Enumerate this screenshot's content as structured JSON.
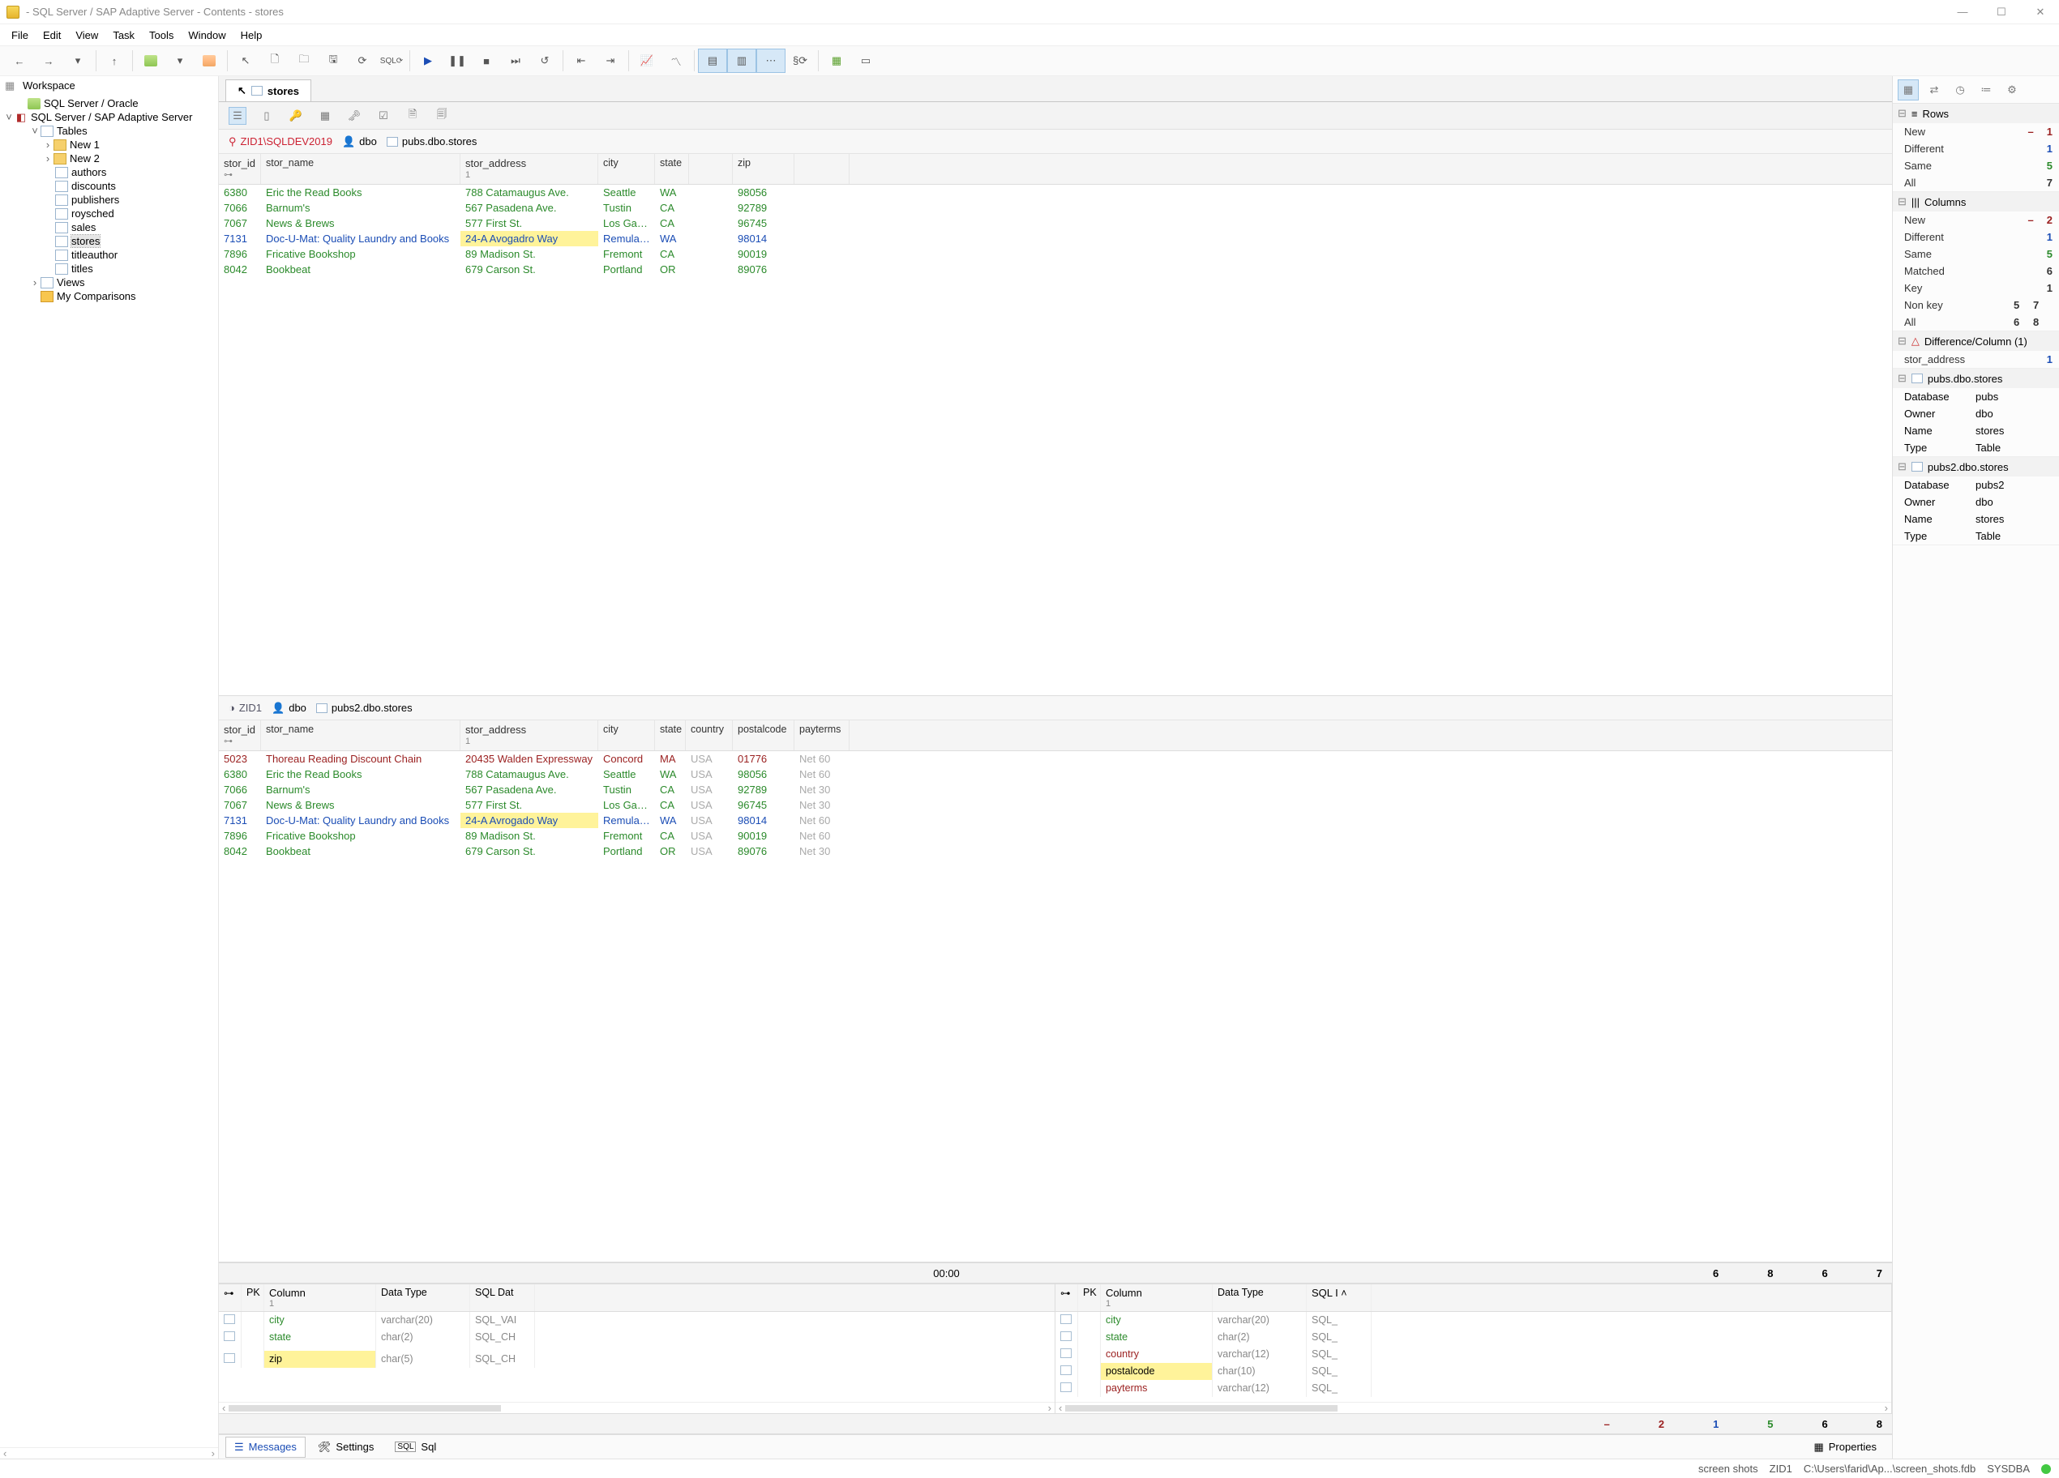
{
  "window": {
    "title": "- SQL Server / SAP Adaptive Server - Contents - stores"
  },
  "menu": [
    "File",
    "Edit",
    "View",
    "Task",
    "Tools",
    "Window",
    "Help"
  ],
  "workspace": {
    "label": "Workspace",
    "nodes": {
      "oracle": "SQL Server / Oracle",
      "sap": "SQL Server / SAP Adaptive Server",
      "tables": "Tables",
      "new1": "New 1",
      "new2": "New 2",
      "authors": "authors",
      "discounts": "discounts",
      "publishers": "publishers",
      "roysched": "roysched",
      "sales": "sales",
      "stores": "stores",
      "titleauthor": "titleauthor",
      "titles": "titles",
      "views": "Views",
      "mycomp": "My Comparisons"
    }
  },
  "tab": {
    "title": "stores"
  },
  "ctx_top": {
    "server": "ZID1\\SQLDEV2019",
    "user": "dbo",
    "path": "pubs.dbo.stores"
  },
  "ctx_bot": {
    "server": "ZID1",
    "user": "dbo",
    "path": "pubs2.dbo.stores"
  },
  "cols_top": [
    "stor_id",
    "stor_name",
    "stor_address",
    "city",
    "state",
    "",
    "zip"
  ],
  "cols_bot": [
    "stor_id",
    "stor_name",
    "stor_address",
    "city",
    "state",
    "country",
    "postalcode",
    "payterms"
  ],
  "subhead": "1",
  "rows_top": [
    {
      "cls": "match",
      "c": [
        "6380",
        "Eric the Read Books",
        "788 Catamaugus Ave.",
        "Seattle",
        "WA",
        "",
        "98056"
      ]
    },
    {
      "cls": "match",
      "c": [
        "7066",
        "Barnum's",
        "567 Pasadena Ave.",
        "Tustin",
        "CA",
        "",
        "92789"
      ]
    },
    {
      "cls": "match",
      "c": [
        "7067",
        "News & Brews",
        "577 First St.",
        "Los Gatos",
        "CA",
        "",
        "96745"
      ]
    },
    {
      "cls": "diff",
      "c": [
        "7131",
        "Doc-U-Mat: Quality Laundry and Books",
        "24-A Avogadro Way",
        "Remulade",
        "WA",
        "",
        "98014"
      ],
      "hl": 2
    },
    {
      "cls": "match",
      "c": [
        "7896",
        "Fricative Bookshop",
        "89 Madison St.",
        "Fremont",
        "CA",
        "",
        "90019"
      ]
    },
    {
      "cls": "match",
      "c": [
        "8042",
        "Bookbeat",
        "679 Carson St.",
        "Portland",
        "OR",
        "",
        "89076"
      ]
    }
  ],
  "rows_bot": [
    {
      "cls": "newrow",
      "c": [
        "5023",
        "Thoreau Reading Discount Chain",
        "20435 Walden Expressway",
        "Concord",
        "MA",
        "USA",
        "01776",
        "Net 60"
      ]
    },
    {
      "cls": "match",
      "c": [
        "6380",
        "Eric the Read Books",
        "788 Catamaugus Ave.",
        "Seattle",
        "WA",
        "USA",
        "98056",
        "Net 60"
      ]
    },
    {
      "cls": "match",
      "c": [
        "7066",
        "Barnum's",
        "567 Pasadena Ave.",
        "Tustin",
        "CA",
        "USA",
        "92789",
        "Net 30"
      ]
    },
    {
      "cls": "match",
      "c": [
        "7067",
        "News & Brews",
        "577 First St.",
        "Los Gatos",
        "CA",
        "USA",
        "96745",
        "Net 30"
      ]
    },
    {
      "cls": "diff",
      "c": [
        "7131",
        "Doc-U-Mat: Quality Laundry and Books",
        "24-A Avrogado Way",
        "Remulade",
        "WA",
        "USA",
        "98014",
        "Net 60"
      ],
      "hl": 2
    },
    {
      "cls": "match",
      "c": [
        "7896",
        "Fricative Bookshop",
        "89 Madison St.",
        "Fremont",
        "CA",
        "USA",
        "90019",
        "Net 60"
      ]
    },
    {
      "cls": "match",
      "c": [
        "8042",
        "Bookbeat",
        "679 Carson St.",
        "Portland",
        "OR",
        "USA",
        "89076",
        "Net 30"
      ]
    }
  ],
  "divbar": {
    "time": "00:00",
    "n1": "6",
    "n2": "8",
    "n3": "6",
    "n4": "7"
  },
  "schema_left": {
    "cols": [
      "",
      "PK",
      "Column",
      "Data Type",
      "SQL Dat"
    ],
    "rows": [
      {
        "name": "city",
        "type": "varchar(20)",
        "sql": "SQL_VAI",
        "cls": "green"
      },
      {
        "name": "state",
        "type": "char(2)",
        "sql": "SQL_CH",
        "cls": "green"
      },
      {
        "name": "",
        "type": "",
        "sql": "",
        "cls": ""
      },
      {
        "name": "zip",
        "type": "char(5)",
        "sql": "SQL_CH",
        "cls": "hl"
      }
    ]
  },
  "schema_right": {
    "cols": [
      "",
      "PK",
      "Column",
      "Data Type",
      "SQL I"
    ],
    "rows": [
      {
        "name": "city",
        "type": "varchar(20)",
        "sql": "SQL_",
        "cls": "green"
      },
      {
        "name": "state",
        "type": "char(2)",
        "sql": "SQL_",
        "cls": "green"
      },
      {
        "name": "country",
        "type": "varchar(12)",
        "sql": "SQL_",
        "cls": "dred"
      },
      {
        "name": "postalcode",
        "type": "char(10)",
        "sql": "SQL_",
        "cls": "hl"
      },
      {
        "name": "payterms",
        "type": "varchar(12)",
        "sql": "SQL_",
        "cls": "dred"
      }
    ]
  },
  "footer_counts": {
    "minus": "–",
    "n1": "2",
    "n2": "1",
    "n3": "5",
    "n4": "6",
    "n5": "8"
  },
  "btabs": {
    "messages": "Messages",
    "settings": "Settings",
    "sql": "Sql",
    "properties": "Properties"
  },
  "rpanel": {
    "rows": {
      "title": "Rows",
      "New": {
        "v": "1",
        "minus": "–",
        "cls": "red"
      },
      "Different": {
        "v": "1",
        "cls": "blue"
      },
      "Same": {
        "v": "5",
        "cls": "green"
      },
      "All": {
        "v": "7"
      }
    },
    "cols": {
      "title": "Columns",
      "New": {
        "v": "2",
        "minus": "–",
        "cls": "red"
      },
      "Different": {
        "v": "1",
        "cls": "blue"
      },
      "Same": {
        "v": "5",
        "cls": "green"
      },
      "Matched": {
        "v": "6"
      },
      "Key": {
        "v": "1"
      },
      "Nonkey": {
        "a": "5",
        "b": "7"
      },
      "All": {
        "a": "6",
        "b": "8"
      }
    },
    "diff": {
      "title": "Difference/Column (1)",
      "item": "stor_address",
      "val": "1"
    },
    "src1": {
      "title": "pubs.dbo.stores",
      "Database": "pubs",
      "Owner": "dbo",
      "Name": "stores",
      "Type": "Table"
    },
    "src2": {
      "title": "pubs2.dbo.stores",
      "Database": "pubs2",
      "Owner": "dbo",
      "Name": "stores",
      "Type": "Table"
    }
  },
  "status": {
    "a": "screen shots",
    "b": "ZID1",
    "c": "C:\\Users\\farid\\Ap...\\screen_shots.fdb",
    "d": "SYSDBA"
  }
}
